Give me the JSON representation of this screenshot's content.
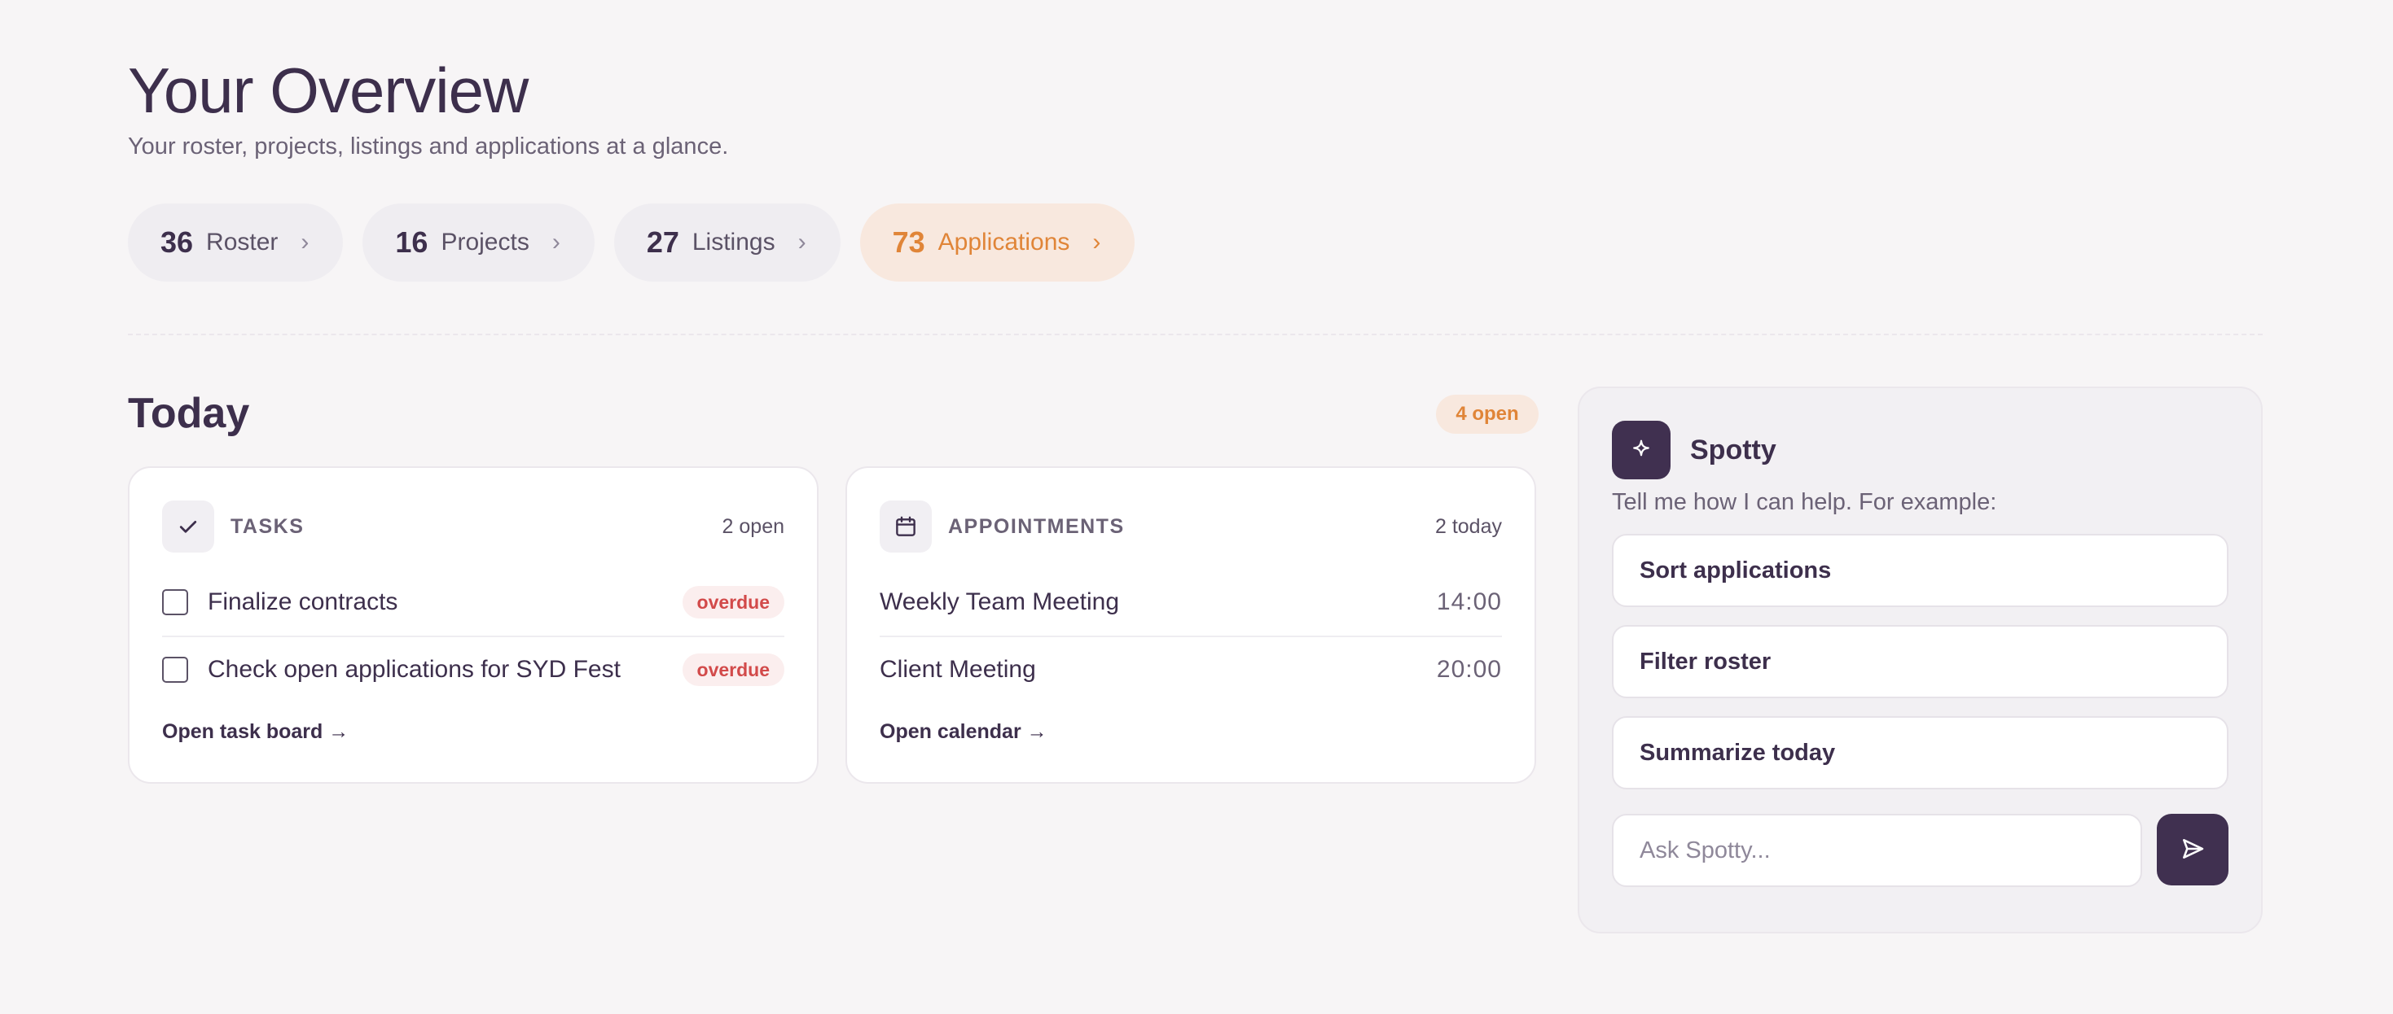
{
  "header": {
    "title": "Your Overview",
    "subtitle": "Your roster, projects, listings and applications at a glance."
  },
  "stats": [
    {
      "count": "36",
      "label": "Roster"
    },
    {
      "count": "16",
      "label": "Projects"
    },
    {
      "count": "27",
      "label": "Listings"
    },
    {
      "count": "73",
      "label": "Applications"
    }
  ],
  "today": {
    "title": "Today",
    "open_badge": "4 open",
    "tasks": {
      "label": "TASKS",
      "count": "2 open",
      "items": [
        {
          "text": "Finalize contracts",
          "badge": "overdue"
        },
        {
          "text": "Check open applications for SYD Fest",
          "badge": "overdue"
        }
      ],
      "link": "Open task board →"
    },
    "appointments": {
      "label": "APPOINTMENTS",
      "count": "2 today",
      "items": [
        {
          "text": "Weekly Team Meeting",
          "time": "14:00"
        },
        {
          "text": "Client Meeting",
          "time": "20:00"
        }
      ],
      "link": "Open calendar →"
    }
  },
  "spotty": {
    "name": "Spotty",
    "intro": "Tell me how I can help. For example:",
    "suggestions": [
      "Sort applications",
      "Filter roster",
      "Summarize today"
    ],
    "input_placeholder": "Ask Spotty...",
    "input_value": ""
  },
  "colors": {
    "background": "#f7f5f6",
    "primary": "#3d2f4c",
    "accent": "#e08538",
    "danger": "#d24a4a"
  },
  "icons": {
    "chevron": "chevron-right-icon",
    "tasks": "check-icon",
    "appointments": "calendar-icon",
    "spotty": "sparkle-icon",
    "send": "send-icon"
  }
}
